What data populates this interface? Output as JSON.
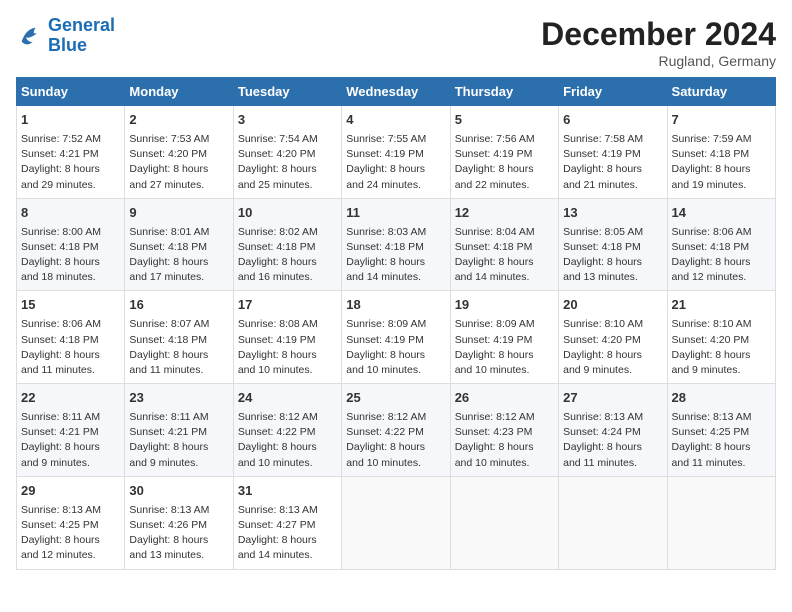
{
  "header": {
    "logo_line1": "General",
    "logo_line2": "Blue",
    "month_year": "December 2024",
    "location": "Rugland, Germany"
  },
  "weekdays": [
    "Sunday",
    "Monday",
    "Tuesday",
    "Wednesday",
    "Thursday",
    "Friday",
    "Saturday"
  ],
  "weeks": [
    [
      {
        "day": "1",
        "info": "Sunrise: 7:52 AM\nSunset: 4:21 PM\nDaylight: 8 hours\nand 29 minutes."
      },
      {
        "day": "2",
        "info": "Sunrise: 7:53 AM\nSunset: 4:20 PM\nDaylight: 8 hours\nand 27 minutes."
      },
      {
        "day": "3",
        "info": "Sunrise: 7:54 AM\nSunset: 4:20 PM\nDaylight: 8 hours\nand 25 minutes."
      },
      {
        "day": "4",
        "info": "Sunrise: 7:55 AM\nSunset: 4:19 PM\nDaylight: 8 hours\nand 24 minutes."
      },
      {
        "day": "5",
        "info": "Sunrise: 7:56 AM\nSunset: 4:19 PM\nDaylight: 8 hours\nand 22 minutes."
      },
      {
        "day": "6",
        "info": "Sunrise: 7:58 AM\nSunset: 4:19 PM\nDaylight: 8 hours\nand 21 minutes."
      },
      {
        "day": "7",
        "info": "Sunrise: 7:59 AM\nSunset: 4:18 PM\nDaylight: 8 hours\nand 19 minutes."
      }
    ],
    [
      {
        "day": "8",
        "info": "Sunrise: 8:00 AM\nSunset: 4:18 PM\nDaylight: 8 hours\nand 18 minutes."
      },
      {
        "day": "9",
        "info": "Sunrise: 8:01 AM\nSunset: 4:18 PM\nDaylight: 8 hours\nand 17 minutes."
      },
      {
        "day": "10",
        "info": "Sunrise: 8:02 AM\nSunset: 4:18 PM\nDaylight: 8 hours\nand 16 minutes."
      },
      {
        "day": "11",
        "info": "Sunrise: 8:03 AM\nSunset: 4:18 PM\nDaylight: 8 hours\nand 14 minutes."
      },
      {
        "day": "12",
        "info": "Sunrise: 8:04 AM\nSunset: 4:18 PM\nDaylight: 8 hours\nand 14 minutes."
      },
      {
        "day": "13",
        "info": "Sunrise: 8:05 AM\nSunset: 4:18 PM\nDaylight: 8 hours\nand 13 minutes."
      },
      {
        "day": "14",
        "info": "Sunrise: 8:06 AM\nSunset: 4:18 PM\nDaylight: 8 hours\nand 12 minutes."
      }
    ],
    [
      {
        "day": "15",
        "info": "Sunrise: 8:06 AM\nSunset: 4:18 PM\nDaylight: 8 hours\nand 11 minutes."
      },
      {
        "day": "16",
        "info": "Sunrise: 8:07 AM\nSunset: 4:18 PM\nDaylight: 8 hours\nand 11 minutes."
      },
      {
        "day": "17",
        "info": "Sunrise: 8:08 AM\nSunset: 4:19 PM\nDaylight: 8 hours\nand 10 minutes."
      },
      {
        "day": "18",
        "info": "Sunrise: 8:09 AM\nSunset: 4:19 PM\nDaylight: 8 hours\nand 10 minutes."
      },
      {
        "day": "19",
        "info": "Sunrise: 8:09 AM\nSunset: 4:19 PM\nDaylight: 8 hours\nand 10 minutes."
      },
      {
        "day": "20",
        "info": "Sunrise: 8:10 AM\nSunset: 4:20 PM\nDaylight: 8 hours\nand 9 minutes."
      },
      {
        "day": "21",
        "info": "Sunrise: 8:10 AM\nSunset: 4:20 PM\nDaylight: 8 hours\nand 9 minutes."
      }
    ],
    [
      {
        "day": "22",
        "info": "Sunrise: 8:11 AM\nSunset: 4:21 PM\nDaylight: 8 hours\nand 9 minutes."
      },
      {
        "day": "23",
        "info": "Sunrise: 8:11 AM\nSunset: 4:21 PM\nDaylight: 8 hours\nand 9 minutes."
      },
      {
        "day": "24",
        "info": "Sunrise: 8:12 AM\nSunset: 4:22 PM\nDaylight: 8 hours\nand 10 minutes."
      },
      {
        "day": "25",
        "info": "Sunrise: 8:12 AM\nSunset: 4:22 PM\nDaylight: 8 hours\nand 10 minutes."
      },
      {
        "day": "26",
        "info": "Sunrise: 8:12 AM\nSunset: 4:23 PM\nDaylight: 8 hours\nand 10 minutes."
      },
      {
        "day": "27",
        "info": "Sunrise: 8:13 AM\nSunset: 4:24 PM\nDaylight: 8 hours\nand 11 minutes."
      },
      {
        "day": "28",
        "info": "Sunrise: 8:13 AM\nSunset: 4:25 PM\nDaylight: 8 hours\nand 11 minutes."
      }
    ],
    [
      {
        "day": "29",
        "info": "Sunrise: 8:13 AM\nSunset: 4:25 PM\nDaylight: 8 hours\nand 12 minutes."
      },
      {
        "day": "30",
        "info": "Sunrise: 8:13 AM\nSunset: 4:26 PM\nDaylight: 8 hours\nand 13 minutes."
      },
      {
        "day": "31",
        "info": "Sunrise: 8:13 AM\nSunset: 4:27 PM\nDaylight: 8 hours\nand 14 minutes."
      },
      {
        "day": "",
        "info": ""
      },
      {
        "day": "",
        "info": ""
      },
      {
        "day": "",
        "info": ""
      },
      {
        "day": "",
        "info": ""
      }
    ]
  ]
}
